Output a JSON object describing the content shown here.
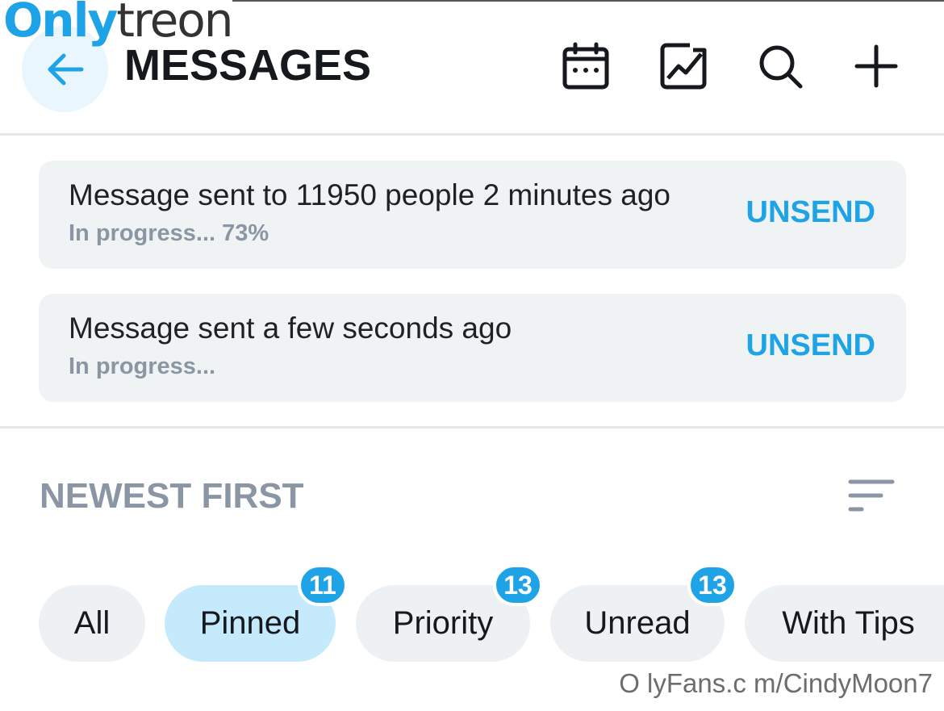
{
  "watermark": {
    "logo_part_a": "Only",
    "logo_part_b": "treon",
    "footer": "O lyFans.c m/CindyMoon7"
  },
  "header": {
    "title": "MESSAGES",
    "icons": [
      "back-arrow-icon",
      "calendar-icon",
      "chart-image-icon",
      "search-icon",
      "plus-icon"
    ]
  },
  "messages": [
    {
      "text": "Message sent to 11950 people 2 minutes ago",
      "status": "In progress... 73%",
      "progress_percent": 73,
      "action": "UNSEND"
    },
    {
      "text": "Message sent a few seconds ago",
      "status": "In progress...",
      "action": "UNSEND"
    }
  ],
  "sort": {
    "label": "NEWEST FIRST",
    "icon": "sort-icon"
  },
  "filters": [
    {
      "label": "All",
      "badge": null,
      "active": false
    },
    {
      "label": "Pinned",
      "badge": "11",
      "active": true
    },
    {
      "label": "Priority",
      "badge": "13",
      "active": false
    },
    {
      "label": "Unread",
      "badge": "13",
      "active": false
    },
    {
      "label": "With Tips",
      "badge": null,
      "active": false
    }
  ],
  "colors": {
    "accent": "#1ea3e6",
    "active_chip": "#c5eafc",
    "chip": "#eef1f3",
    "card": "#f0f3f4",
    "muted_text": "#8a96a3"
  }
}
